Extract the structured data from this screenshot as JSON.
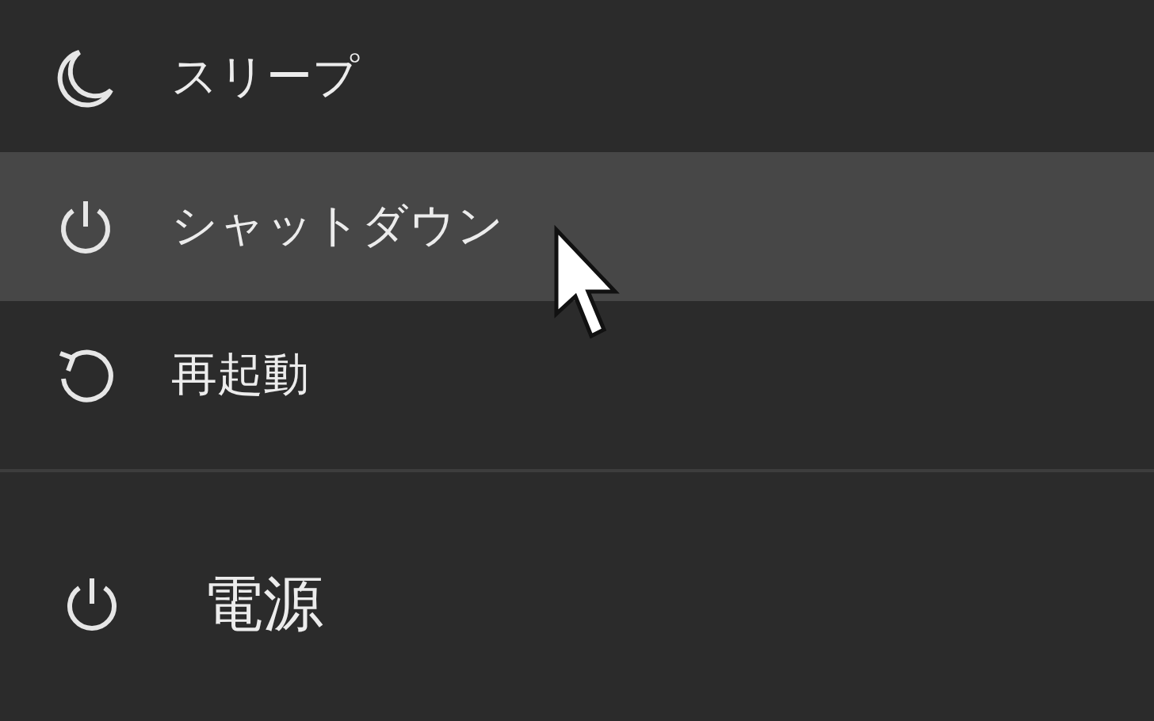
{
  "menu": {
    "items": [
      {
        "kind": "sleep",
        "label": "スリープ",
        "selected": false
      },
      {
        "kind": "shutdown",
        "label": "シャットダウン",
        "selected": true
      },
      {
        "kind": "restart",
        "label": "再起動",
        "selected": false
      }
    ]
  },
  "power_button": {
    "label": "電源"
  }
}
